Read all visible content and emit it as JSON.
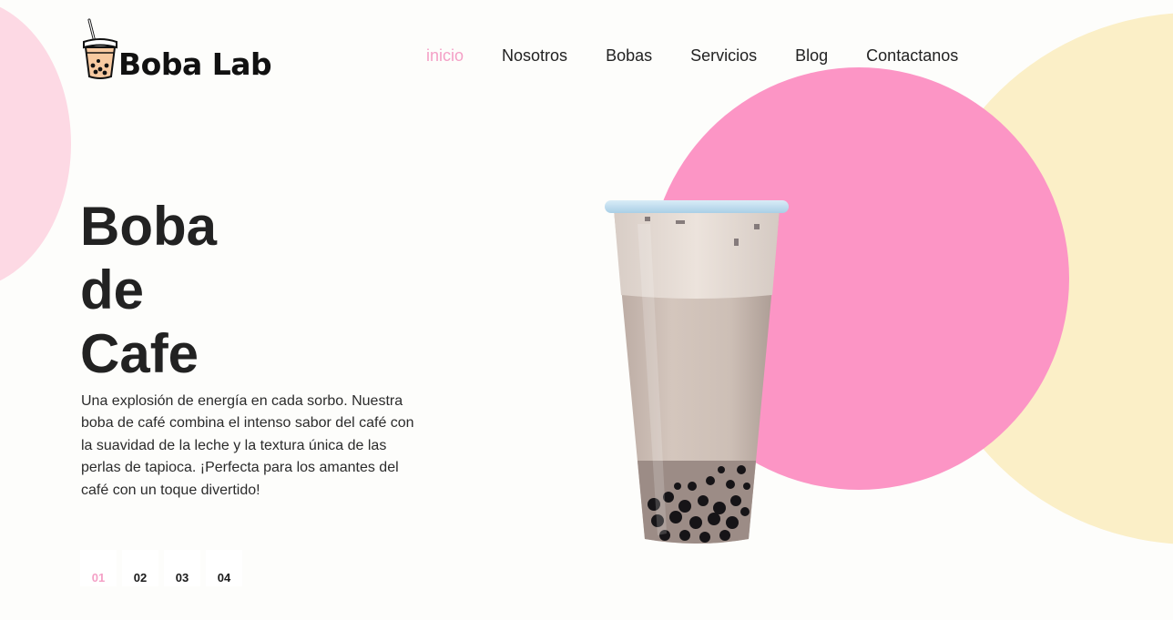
{
  "brand": {
    "name": "Boba Lab",
    "logo_icon": "bubble-tea-cup-icon"
  },
  "nav": {
    "items": [
      {
        "label": "inicio",
        "active": true
      },
      {
        "label": "Nosotros",
        "active": false
      },
      {
        "label": "Bobas",
        "active": false
      },
      {
        "label": "Servicios",
        "active": false
      },
      {
        "label": "Blog",
        "active": false
      },
      {
        "label": "Contactanos",
        "active": false
      }
    ]
  },
  "hero": {
    "title_lines": [
      "Boba",
      "de",
      "Cafe"
    ],
    "description": "Una explosión de energía en cada sorbo. Nuestra boba de café combina el intenso sabor del café con la suavidad de la leche y la textura única de las perlas de tapioca. ¡Perfecta para los amantes del café con un toque divertido!",
    "product_image": "coffee-boba-cup-image"
  },
  "pager": {
    "items": [
      "01",
      "02",
      "03",
      "04"
    ],
    "active_index": 0
  },
  "colors": {
    "accent_pink": "#fc95c5",
    "active_text": "#f4a0c6",
    "soft_pink": "#fdd9e4",
    "cream": "#fbefc7",
    "text_dark": "#222222"
  }
}
